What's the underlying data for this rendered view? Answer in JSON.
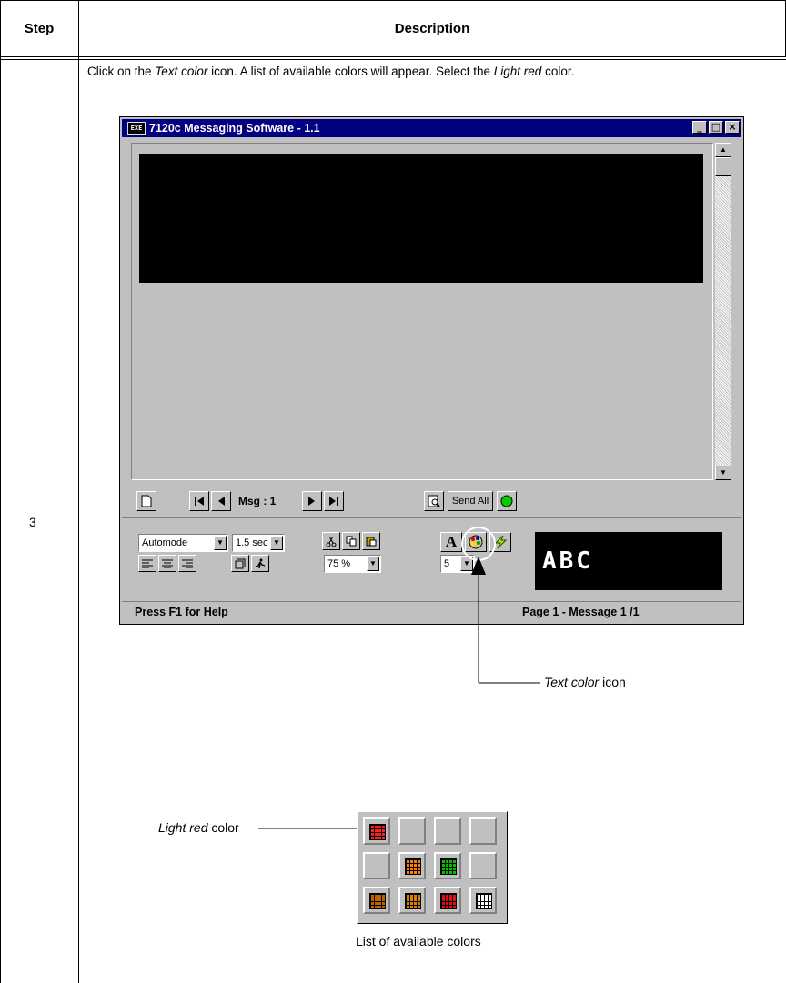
{
  "table": {
    "col_step": "Step",
    "col_description": "Description",
    "step_number": "3",
    "instruction": {
      "part1": "Click on the ",
      "text_color_em": "Text color",
      "part2": " icon. A list of available colors will appear. Select the ",
      "light_red_em": "Light red",
      "part3": " color."
    }
  },
  "window": {
    "title": "7120c  Messaging Software - 1.1",
    "app_icon_label": "EXE",
    "minimize": "_",
    "maximize": "□",
    "close": "×",
    "nav": {
      "msg_label": "Msg : 1",
      "send_all": "Send All"
    },
    "controls": {
      "mode": "Automode",
      "time": "1.5 sec",
      "zoom": "75 %",
      "font_size": "5",
      "bold_letter": "A"
    },
    "preview_text": "ABC",
    "status_left": "Press F1 for Help",
    "status_right": "Page 1  - Message 1  /1",
    "colors": {
      "titlebar": "#000080",
      "face": "#c0c0c0",
      "status_led": "#00cc00"
    }
  },
  "callouts": {
    "text_color_em": "Text color",
    "text_color_rest": " icon",
    "light_red_em": "Light red",
    "light_red_rest": " color",
    "palette_caption": "List of available colors"
  },
  "palette": {
    "swatches": [
      [
        "#ff2020",
        "",
        "",
        ""
      ],
      [
        "",
        "#ff8000",
        "#00c000",
        ""
      ],
      [
        "#c06000",
        "#e08000",
        "#e01010",
        "#ffffff"
      ]
    ]
  }
}
